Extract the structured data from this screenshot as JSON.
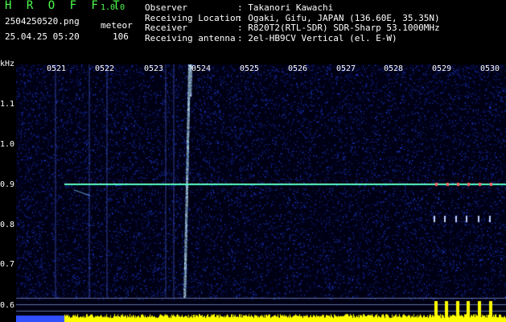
{
  "header": {
    "app_name": "H R O F F T",
    "version": "1.0.0",
    "file_name": "2504250520.png",
    "meteor_label": "meteor",
    "date_time": "25.04.25 05:20",
    "meteor_count": "106"
  },
  "info": [
    {
      "key": "Observer",
      "value": ": Takanori Kawachi"
    },
    {
      "key": "Receiving Location",
      "value": ": Ogaki, Gifu, JAPAN (136.60E, 35.35N)"
    },
    {
      "key": "Receiver",
      "value": ": R820T2(RTL-SDR) SDR-Sharp 53.1000MHz"
    },
    {
      "key": "Receiving antenna",
      "value": ": 2el-HB9CV Vertical (el. E-W)"
    }
  ],
  "axes": {
    "y_unit": "kHz",
    "y_ticks": [
      "1.1",
      "1.0",
      "0.9",
      "0.8",
      "0.7",
      "0.6"
    ],
    "x_ticks": [
      "0521",
      "0522",
      "0523",
      "0524",
      "0525",
      "0526",
      "0527",
      "0528",
      "0529",
      "0530"
    ]
  },
  "colors": {
    "background": "#000000",
    "noise": "#0a1a8a",
    "carrier": "#40ffd0",
    "meteor": "#80e0ff",
    "level_bar": "#ffff00"
  }
}
